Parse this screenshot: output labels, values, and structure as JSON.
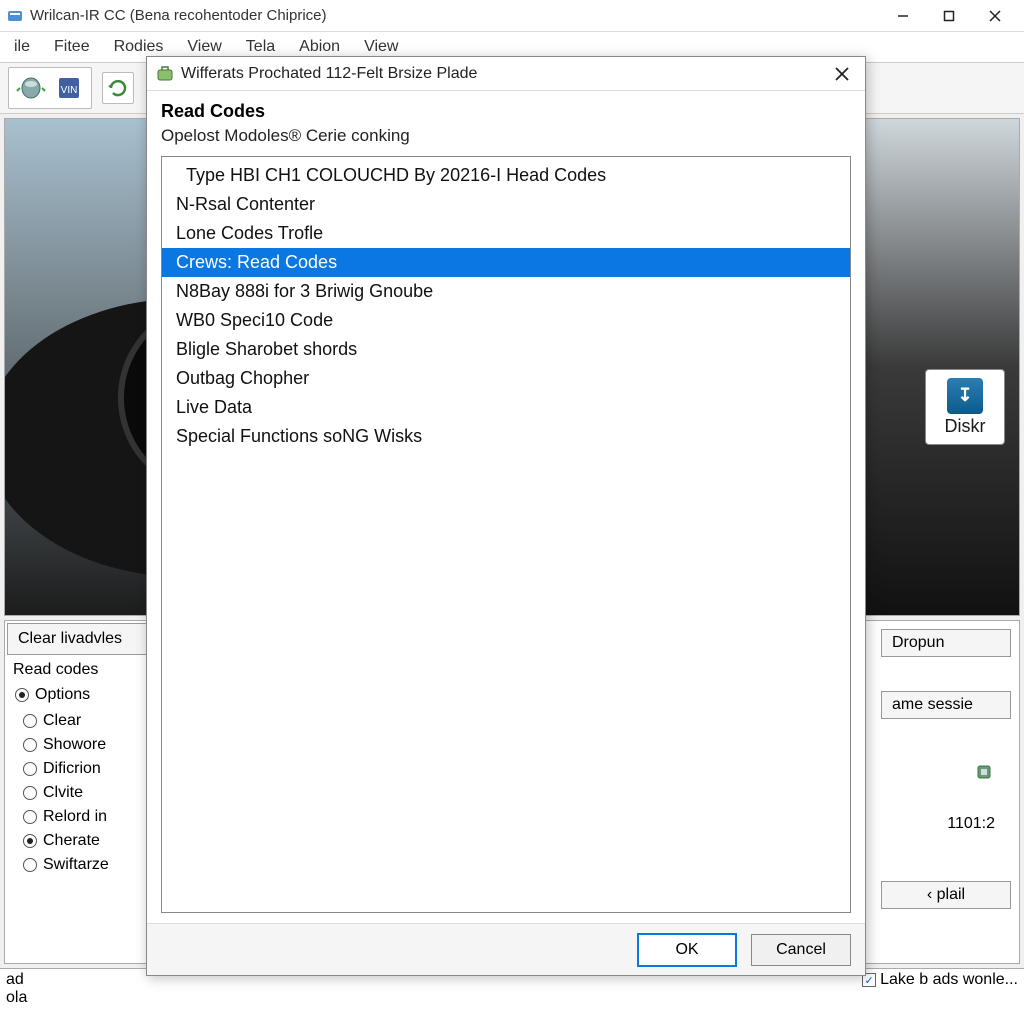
{
  "main": {
    "title": "Wrilcan-IR CC  (Bena recohentoder Chiprice)",
    "menu": [
      "ile",
      "Fitee",
      "Rodies",
      "View",
      "Tela",
      "Abion",
      "View"
    ]
  },
  "left_panel": {
    "btn_clear": "Clear livadvles",
    "label_read": "Read codes",
    "options_label": "Options",
    "radios": [
      {
        "label": "Clear",
        "checked": false
      },
      {
        "label": "Showore",
        "checked": false
      },
      {
        "label": "Dificrion",
        "checked": false
      },
      {
        "label": "Clvite",
        "checked": false
      },
      {
        "label": "Relord in",
        "checked": false
      },
      {
        "label": "Cherate",
        "checked": true
      },
      {
        "label": "Swiftarze",
        "checked": false
      }
    ]
  },
  "right_panel": {
    "btn_dropun": "Dropun",
    "btn_sessie": "ame sessie",
    "num": "1101:2",
    "btn_plail": "‹ plail"
  },
  "diskr": "Diskr",
  "status": {
    "line1": "ad",
    "line2": "ola",
    "check_label": "Lake b ads wonle..."
  },
  "modal": {
    "title": "Wifferats Prochated 112-Felt Brsize Plade",
    "heading": "Read Codes",
    "subtitle": "Opelost Modoles® Cerie conking",
    "items": [
      {
        "label": "Type HBI CH1 COLOUCHD By 20216-I Head Codes",
        "selected": false
      },
      {
        "label": "N-Rsal Contenter",
        "selected": false
      },
      {
        "label": "Lone Codes Trofle",
        "selected": false
      },
      {
        "label": "Crews: Read Codes",
        "selected": true
      },
      {
        "label": "N8Bay 888i for 3 Briwig Gnoube",
        "selected": false
      },
      {
        "label": "WB0 Speci10 Code",
        "selected": false
      },
      {
        "label": "Bligle Sharobet shords",
        "selected": false
      },
      {
        "label": "Outbag Chopher",
        "selected": false
      },
      {
        "label": "Live Data",
        "selected": false
      },
      {
        "label": "Special Functions soNG Wisks",
        "selected": false
      }
    ],
    "ok": "OK",
    "cancel": "Cancel"
  }
}
